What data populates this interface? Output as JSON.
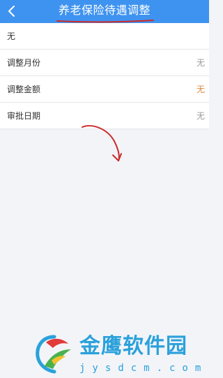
{
  "header": {
    "title": "养老保险待遇调整",
    "back_icon": "chevron-left-icon",
    "background_color": "#3f93f0"
  },
  "list": {
    "rows": [
      {
        "label": "无",
        "value": ""
      },
      {
        "label": "调整月份",
        "value": "无"
      },
      {
        "label": "调整金额",
        "value": "无",
        "value_color": "#d98a3f"
      },
      {
        "label": "审批日期",
        "value": "无"
      }
    ]
  },
  "annotations": {
    "underline_color": "#cc2a2a",
    "arrow_color": "#cc2a2a"
  },
  "watermark": {
    "name": "金鹰软件园",
    "url": "jysdcm.com",
    "color": "#2aa1db"
  }
}
